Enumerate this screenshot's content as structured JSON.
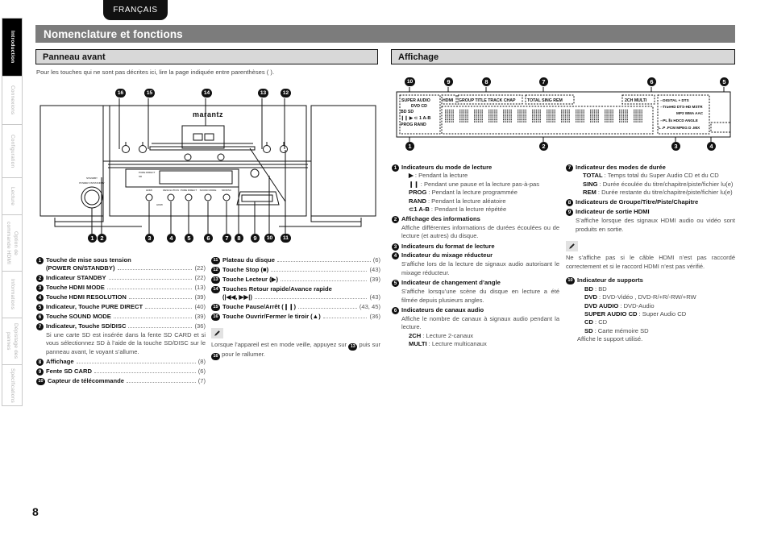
{
  "language_tab": "FRANÇAIS",
  "page_number": "8",
  "sidebar": {
    "items": [
      {
        "label": "Introduction",
        "active": true
      },
      {
        "label": "Connexions",
        "active": false
      },
      {
        "label": "Configuration",
        "active": false
      },
      {
        "label": "Lecture",
        "active": false
      },
      {
        "label": "Option de commande HDMI",
        "active": false
      },
      {
        "label": "Informations",
        "active": false
      },
      {
        "label": "Dépistage des pannes",
        "active": false
      },
      {
        "label": "Spécifications",
        "active": false
      }
    ]
  },
  "header": {
    "title": "Nomenclature et fonctions",
    "section_front": "Panneau avant",
    "section_display": "Affichage",
    "intro": "Pour les touches qui ne sont pas décrites ici, lire la page indiquée entre parenthèses ( )."
  },
  "front_panel_figure": {
    "brand": "marantz",
    "top_callouts": [
      "16",
      "15",
      "14",
      "13",
      "12"
    ],
    "bottom_callouts": [
      "1",
      "2",
      "3",
      "4",
      "5",
      "6",
      "7",
      "8",
      "9",
      "10",
      "11"
    ],
    "button_labels": [
      "STANDBY",
      "POWER ON/STANDBY",
      "HDMI",
      "MODE",
      "RESOLUTION",
      "PURE DIRECT",
      "SOUND MODE",
      "SD/DISC"
    ]
  },
  "display_figure": {
    "top_callouts": [
      "10",
      "9",
      "8",
      "7",
      "6",
      "5"
    ],
    "bottom_callouts": [
      "1",
      "2",
      "3",
      "4"
    ],
    "labels": {
      "media": [
        "SUPER AUDIO",
        "DVD",
        "CD",
        "BD",
        "SD"
      ],
      "play_modes": [
        "PROG",
        "RAND",
        "1",
        "A-B"
      ],
      "hdmi": "HDMI",
      "group_row": [
        "GROUP",
        "TITLE",
        "TRACK",
        "CHAP"
      ],
      "time_row": [
        "TOTAL",
        "SING",
        "REM"
      ],
      "channels": [
        "2CH",
        "MULTI"
      ],
      "formats_1": "DIGITAL + DTS",
      "formats_2": "TrueHD DTS-HD MSTR",
      "formats_3": "MP3 WMA AAC",
      "formats_4": "PL IIx HDCD ANGLE",
      "formats_5": "L P PCM MPEG D.MIX"
    }
  },
  "front_panel_entries": [
    {
      "num": "1",
      "label": "Touche de mise sous tension",
      "label2": "(POWER ON/STANDBY)",
      "page": "(22)"
    },
    {
      "num": "2",
      "label": "Indicateur STANDBY",
      "page": "(22)"
    },
    {
      "num": "3",
      "label": "Touche HDMI MODE",
      "page": "(13)"
    },
    {
      "num": "4",
      "label": "Touche HDMI RESOLUTION",
      "page": "(39)"
    },
    {
      "num": "5",
      "label": "Indicateur, Touche PURE DIRECT",
      "page": "(40)"
    },
    {
      "num": "6",
      "label": "Touche SOUND MODE",
      "page": "(39)"
    },
    {
      "num": "7",
      "label": "Indicateur, Touche SD/DISC",
      "page": "(36)",
      "desc": "Si une carte SD est insérée dans la fente SD CARD et si vous sélectionnez SD à l’aide de la touche SD/DISC sur le panneau avant, le voyant s’allume."
    },
    {
      "num": "8",
      "label": "Affichage",
      "page": "(8)"
    },
    {
      "num": "9",
      "label": "Fente SD CARD",
      "page": "(6)"
    },
    {
      "num": "10",
      "label": "Capteur de télécommande",
      "page": "(7)"
    }
  ],
  "front_panel_entries_2": [
    {
      "num": "11",
      "label": "Plateau du disque",
      "page": "(6)"
    },
    {
      "num": "12",
      "label": "Touche Stop (■)",
      "page": "(43)"
    },
    {
      "num": "13",
      "label": "Touche Lecteur (▶)",
      "page": "(39)"
    },
    {
      "num": "14",
      "label": "Touches Retour rapide/Avance rapide",
      "label2": "(|◀◀, ▶▶|)",
      "page": "(43)"
    },
    {
      "num": "15",
      "label": "Touche Pause/Arrêt (❙❙)",
      "page": "(43, 45)"
    },
    {
      "num": "16",
      "label": "Touche Ouvrir/Fermer le tiroir (▲)",
      "page": "(36)"
    }
  ],
  "front_panel_note": {
    "icon": "pencil-icon",
    "text_a": "Lorsque l’appareil est en mode veille, appuyez sur ",
    "num_a": "13",
    "text_b": " puis sur ",
    "num_b": "16",
    "text_c": " pour le rallumer."
  },
  "display_entries_left": [
    {
      "num": "1",
      "label": "Indicateurs du mode de lecture",
      "subs": [
        {
          "k": "▶",
          "v": ": Pendant la lecture"
        },
        {
          "k": "❙❙",
          "v": ": Pendant une pause et la lecture pas-à-pas"
        },
        {
          "k": "PROG",
          "v": ": Pendant la lecture programmée"
        },
        {
          "k": "RAND",
          "v": ": Pendant la lecture aléatoire"
        },
        {
          "k": "⊂1 A-B",
          "v": ": Pendant la lecture répétée"
        }
      ]
    },
    {
      "num": "2",
      "label": "Affichage des informations",
      "desc": "Affiche différentes informations de durées écoulées ou de lecture (et autres) du disque."
    },
    {
      "num": "3",
      "label": "Indicateurs du format de lecture"
    },
    {
      "num": "4",
      "label": "Indicateur du mixage réducteur",
      "desc": "S’affiche lors de la lecture de signaux audio autorisant le mixage réducteur."
    },
    {
      "num": "5",
      "label": "Indicateur de changement d’angle",
      "desc": "S’affiche lorsqu’une scène du disque en lecture a été filmée depuis plusieurs angles."
    },
    {
      "num": "6",
      "label": "Indicateurs de canaux audio",
      "desc": "Affiche le nombre de canaux à signaux audio pendant la lecture.",
      "subs": [
        {
          "k": "2CH",
          "v": ": Lecture 2-canaux"
        },
        {
          "k": "MULTI",
          "v": ": Lecture multicanaux"
        }
      ]
    }
  ],
  "display_entries_right": [
    {
      "num": "7",
      "label": "Indicateur des modes de durée",
      "subs": [
        {
          "k": "TOTAL",
          "v": ": Temps total du Super Audio CD et du CD"
        },
        {
          "k": "SING",
          "v": ": Durée écoulée du titre/chapitre/piste/fichier lu(e)"
        },
        {
          "k": "REM",
          "v": ": Durée restante du titre/chapitre/piste/fichier lu(e)"
        }
      ]
    },
    {
      "num": "8",
      "label": "Indicateurs de Groupe/Titre/Piste/Chapitre"
    },
    {
      "num": "9",
      "label": "Indicateur de sortie HDMI",
      "desc": "S’affiche lorsque des signaux HDMI audio ou vidéo sont produits en sortie."
    }
  ],
  "display_note": {
    "icon": "pencil-icon",
    "text": "Ne s’affiche pas si le câble HDMI n’est pas raccordé correctement et si le raccord HDMI n’est pas vérifié."
  },
  "display_entry_media": {
    "num": "10",
    "label": "Indicateur de supports",
    "subs": [
      {
        "k": "BD",
        "v": ": BD"
      },
      {
        "k": "DVD",
        "v": ": DVD-Vidéo , DVD-R/+R/-RW/+RW"
      },
      {
        "k": "DVD AUDIO",
        "v": ": DVD-Audio"
      },
      {
        "k": "SUPER AUDIO CD",
        "v": ": Super Audio CD"
      },
      {
        "k": "CD",
        "v": ": CD"
      },
      {
        "k": "SD",
        "v": ": Carte mémoire SD"
      }
    ],
    "footer": "Affiche le support utilisé."
  },
  "colors": {
    "title_bar": "#7c7c7c",
    "section_bar": "#d8d8d8",
    "accent_black": "#111111",
    "muted_text": "#4a4a4a"
  }
}
